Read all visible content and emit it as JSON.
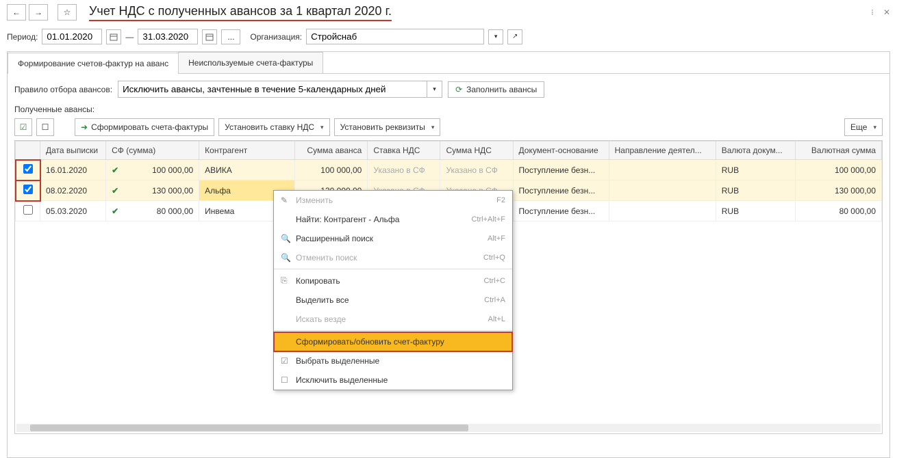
{
  "title": "Учет НДС с полученных авансов за 1 квартал 2020 г.",
  "navBack": "←",
  "navFwd": "→",
  "period": {
    "label": "Период:",
    "from": "01.01.2020",
    "dash": "—",
    "to": "31.03.2020"
  },
  "org": {
    "label": "Организация:",
    "value": "Стройснаб"
  },
  "tabs": {
    "t1": "Формирование счетов-фактур на аванс",
    "t2": "Неиспользуемые счета-фактуры"
  },
  "filter": {
    "label": "Правило отбора авансов:",
    "value": "Исключить авансы, зачтенные в течение 5-календарных дней",
    "fillBtn": "Заполнить авансы"
  },
  "section": "Полученные авансы:",
  "toolbar": {
    "form": "Сформировать счета-фактуры",
    "rate": "Установить ставку НДС",
    "props": "Установить реквизиты",
    "more": "Еще"
  },
  "columns": {
    "chk": "",
    "date": "Дата выписки",
    "sf": "СФ (сумма)",
    "contr": "Контрагент",
    "sum": "Сумма аванса",
    "rate": "Ставка НДС",
    "vat": "Сумма НДС",
    "doc": "Документ-основание",
    "dir": "Направление деятел...",
    "curr": "Валюта докум...",
    "csum": "Валютная сумма"
  },
  "rows": [
    {
      "chk": true,
      "date": "16.01.2020",
      "sfSum": "100 000,00",
      "contr": "АВИКА",
      "sum": "100 000,00",
      "rate": "Указано в СФ",
      "vat": "Указано в СФ",
      "doc": "Поступление безн...",
      "dir": "",
      "curr": "RUB",
      "csum": "100 000,00",
      "sel": true,
      "hlContr": false
    },
    {
      "chk": true,
      "date": "08.02.2020",
      "sfSum": "130 000,00",
      "contr": "Альфа",
      "sum": "130 000,00",
      "rate": "Указано в СФ",
      "vat": "Указано в СФ",
      "doc": "Поступление безн...",
      "dir": "",
      "curr": "RUB",
      "csum": "130 000,00",
      "sel": true,
      "hlContr": true
    },
    {
      "chk": false,
      "date": "05.03.2020",
      "sfSum": "80 000,00",
      "contr": "Инвема",
      "sum": "",
      "rate": "",
      "vat": "",
      "doc": "Поступление безн...",
      "dir": "",
      "curr": "RUB",
      "csum": "80 000,00",
      "sel": false,
      "hlContr": false
    }
  ],
  "contextMenu": [
    {
      "icon": "✎",
      "label": "Изменить",
      "shortcut": "F2",
      "disabled": true
    },
    {
      "icon": "",
      "label": "Найти: Контрагент - Альфа",
      "shortcut": "Ctrl+Alt+F"
    },
    {
      "icon": "🔍",
      "label": "Расширенный поиск",
      "shortcut": "Alt+F"
    },
    {
      "icon": "🔍",
      "label": "Отменить поиск",
      "shortcut": "Ctrl+Q",
      "disabled": true
    },
    {
      "sep": true
    },
    {
      "icon": "⎘",
      "label": "Копировать",
      "shortcut": "Ctrl+C"
    },
    {
      "icon": "",
      "label": "Выделить все",
      "shortcut": "Ctrl+A"
    },
    {
      "icon": "",
      "label": "Искать везде",
      "shortcut": "Alt+L",
      "disabled": true
    },
    {
      "sep": true
    },
    {
      "icon": "",
      "label": "Сформировать/обновить счет-фактуру",
      "shortcut": "",
      "highlight": true
    },
    {
      "icon": "☑",
      "label": "Выбрать выделенные",
      "shortcut": ""
    },
    {
      "icon": "☐",
      "label": "Исключить выделенные",
      "shortcut": ""
    }
  ]
}
